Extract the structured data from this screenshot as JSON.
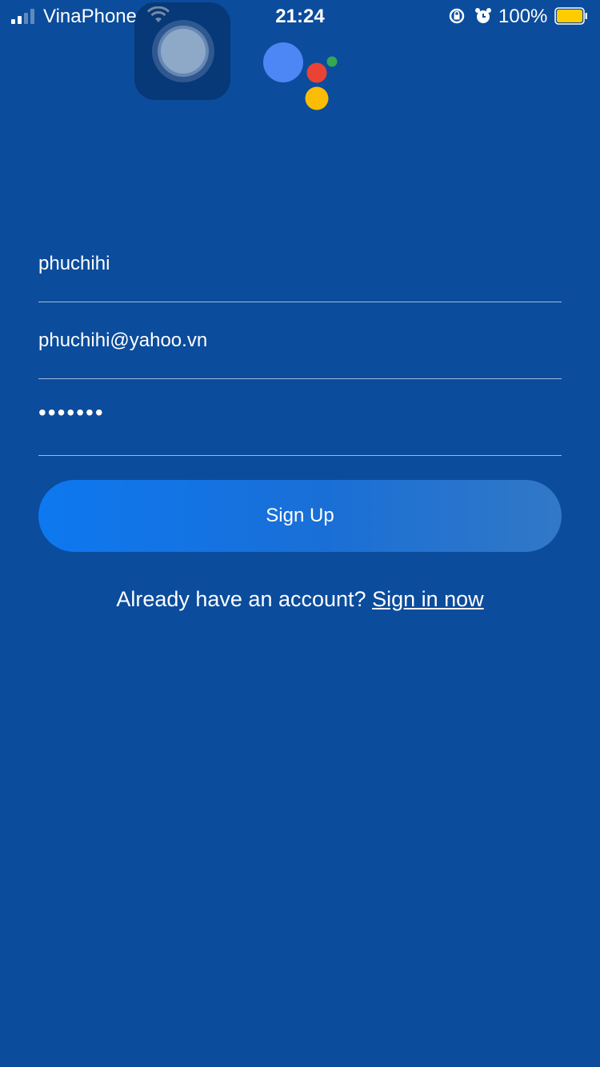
{
  "status_bar": {
    "carrier": "VinaPhone",
    "time": "21:24",
    "battery_percent": "100%",
    "battery_color": "#ffcc00",
    "icons": [
      "signal-icon",
      "wifi-icon",
      "rotation-lock-icon",
      "alarm-icon",
      "battery-icon"
    ]
  },
  "logo": {
    "colors": [
      "#4d86f5",
      "#ea4335",
      "#34a853",
      "#fbbc05"
    ]
  },
  "form": {
    "username_value": "phuchihi",
    "email_value": "phuchihi@yahoo.vn",
    "password_value": "•••••••",
    "submit_label": "Sign Up"
  },
  "footer": {
    "prompt": "Already have an account?",
    "link_label": "Sign in now"
  },
  "colors": {
    "background": "#0b4c9c",
    "button_start": "#0d78f0",
    "button_end": "#3278c6"
  }
}
